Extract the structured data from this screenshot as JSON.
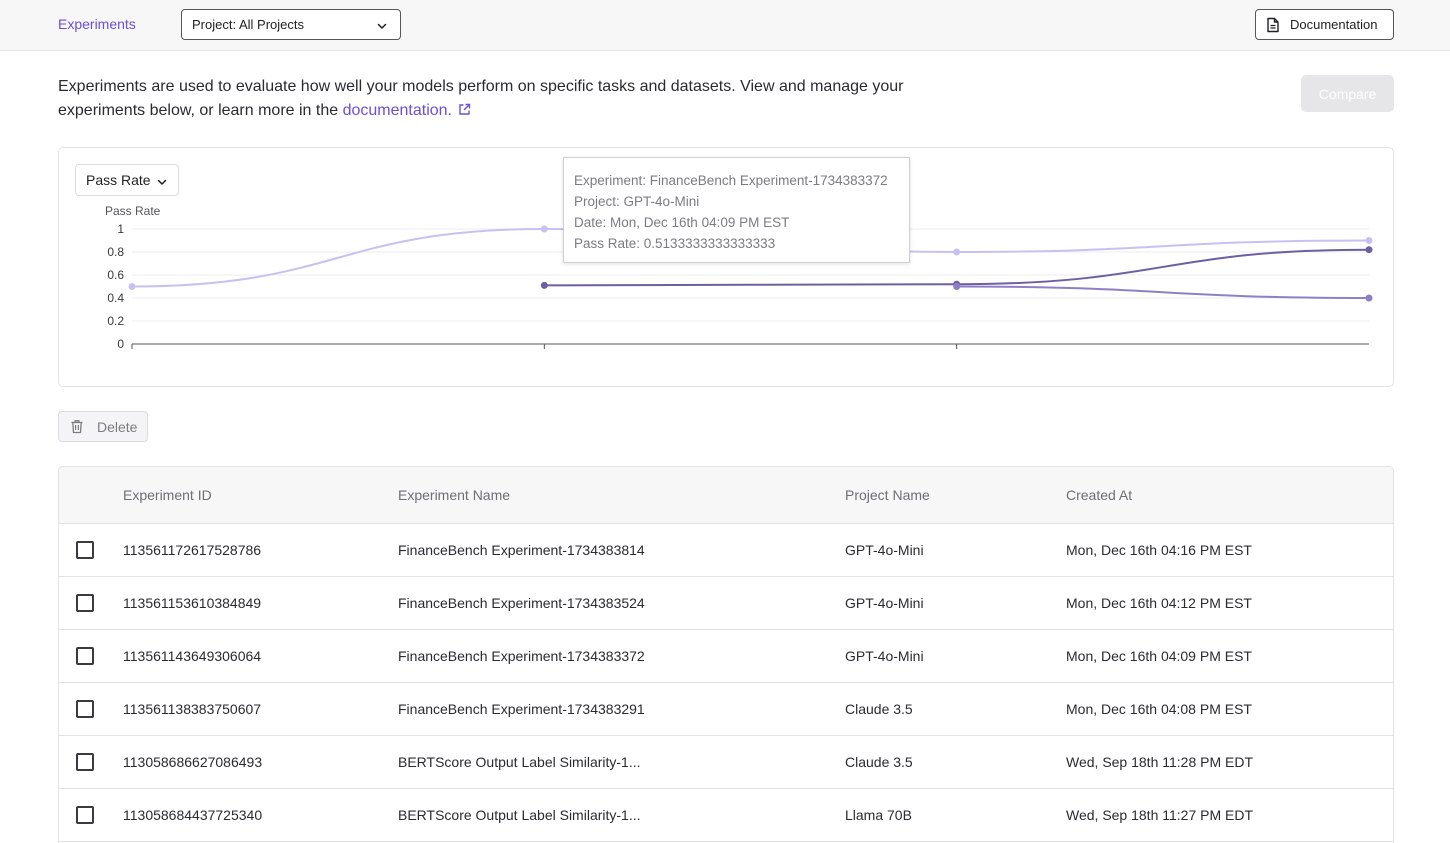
{
  "nav": {
    "experiments_label": "Experiments"
  },
  "project_filter": {
    "value": "Project: All Projects"
  },
  "documentation_button": {
    "label": "Documentation"
  },
  "intro": {
    "text_before": "Experiments are used to evaluate how well your models perform on specific tasks and datasets. View and manage your experiments below, or learn more in the ",
    "link_text": "documentation.",
    "text_after": ""
  },
  "compare_button": {
    "label": "Compare"
  },
  "metric_select": {
    "value": "Pass Rate"
  },
  "chart_data": {
    "type": "line",
    "ylabel": "Pass Rate",
    "ylim": [
      0,
      1
    ],
    "yticks": [
      0,
      0.2,
      0.4,
      0.6,
      0.8,
      1
    ],
    "x_count": 4,
    "grid": true,
    "series": [
      {
        "color": "#c9c0f2",
        "values": [
          0.5,
          1.0,
          0.8,
          0.9
        ]
      },
      {
        "color": "#6e5fa3",
        "values": [
          null,
          0.51,
          0.52,
          0.82
        ]
      },
      {
        "color": "#8f80c6",
        "values": [
          null,
          null,
          0.5,
          0.4
        ]
      }
    ]
  },
  "tooltip": {
    "experiment": "Experiment: FinanceBench Experiment-1734383372",
    "project": "Project: GPT-4o-Mini",
    "date": "Date: Mon, Dec 16th 04:09 PM EST",
    "pass_rate": "Pass Rate: 0.5133333333333333"
  },
  "delete_button": {
    "label": "Delete"
  },
  "table": {
    "headers": [
      "Experiment ID",
      "Experiment Name",
      "Project Name",
      "Created At"
    ],
    "rows": [
      {
        "id": "113561172617528786",
        "name": "FinanceBench Experiment-1734383814",
        "project": "GPT-4o-Mini",
        "created": "Mon, Dec 16th 04:16 PM EST"
      },
      {
        "id": "113561153610384849",
        "name": "FinanceBench Experiment-1734383524",
        "project": "GPT-4o-Mini",
        "created": "Mon, Dec 16th 04:12 PM EST"
      },
      {
        "id": "113561143649306064",
        "name": "FinanceBench Experiment-1734383372",
        "project": "GPT-4o-Mini",
        "created": "Mon, Dec 16th 04:09 PM EST"
      },
      {
        "id": "113561138383750607",
        "name": "FinanceBench Experiment-1734383291",
        "project": "Claude 3.5",
        "created": "Mon, Dec 16th 04:08 PM EST"
      },
      {
        "id": "113058686627086493",
        "name": "BERTScore Output Label Similarity-1...",
        "project": "Claude 3.5",
        "created": "Wed, Sep 18th 11:28 PM EDT"
      },
      {
        "id": "113058684437725340",
        "name": "BERTScore Output Label Similarity-1...",
        "project": "Llama 70B",
        "created": "Wed, Sep 18th 11:27 PM EDT"
      }
    ]
  },
  "colors": {
    "accent": "#6d4fd6",
    "border": "#e3e3e6"
  }
}
